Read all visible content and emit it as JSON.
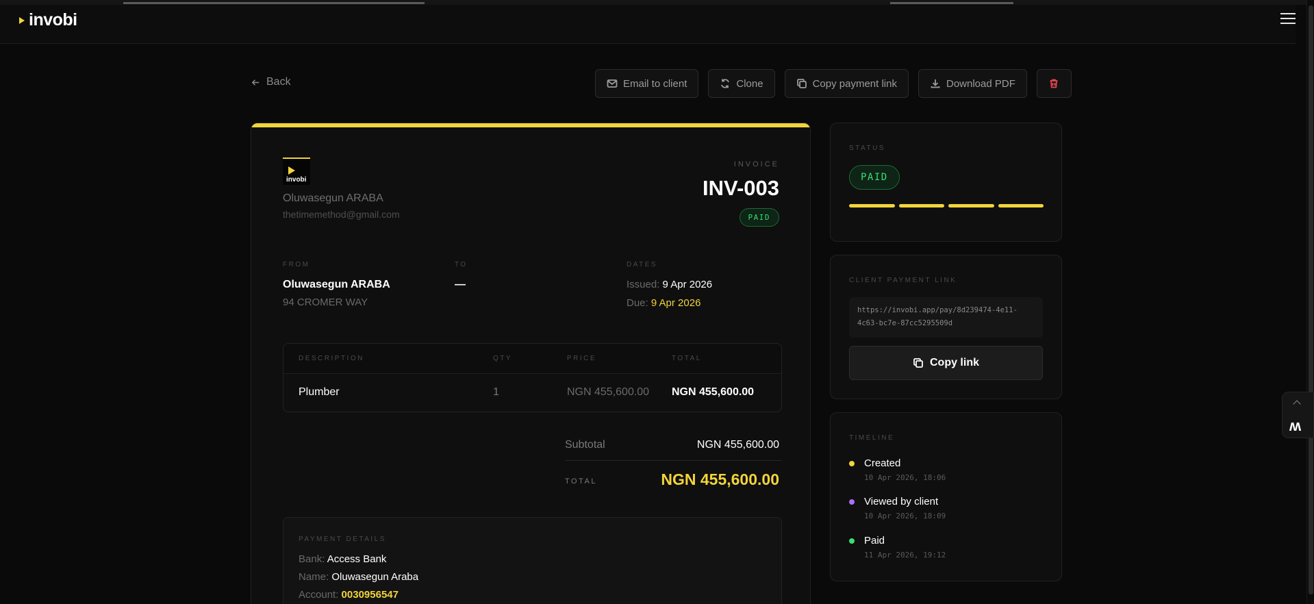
{
  "app": {
    "logo_text": "invobi"
  },
  "toolbar": {
    "back_label": "Back",
    "email_label": "Email to client",
    "clone_label": "Clone",
    "copy_payment_link_label": "Copy payment link",
    "download_pdf_label": "Download PDF"
  },
  "invoice": {
    "brand_text": "invobi",
    "sender_name": "Oluwasegun ARABA",
    "sender_email": "thetimemethod@gmail.com",
    "label": "INVOICE",
    "number": "INV-003",
    "status": "PAID",
    "from_label": "FROM",
    "from_name": "Oluwasegun ARABA",
    "from_address": "94 CROMER WAY",
    "to_label": "TO",
    "to_value": "—",
    "dates_label": "DATES",
    "issued_label": "Issued:",
    "issued_value": "9 Apr 2026",
    "due_label": "Due:",
    "due_value": "9 Apr 2026",
    "columns": [
      "DESCRIPTION",
      "QTY",
      "PRICE",
      "TOTAL"
    ],
    "items": [
      {
        "description": "Plumber",
        "qty": "1",
        "price": "NGN 455,600.00",
        "total": "NGN 455,600.00"
      }
    ],
    "subtotal_label": "Subtotal",
    "subtotal_value": "NGN 455,600.00",
    "total_label": "TOTAL",
    "total_value": "NGN 455,600.00",
    "payment": {
      "label": "PAYMENT DETAILS",
      "bank_label": "Bank:",
      "bank_value": "Access Bank",
      "name_label": "Name:",
      "name_value": "Oluwasegun Araba",
      "account_label": "Account:",
      "account_value": "0030956547"
    }
  },
  "status_panel": {
    "label": "STATUS",
    "badge": "PAID",
    "progress_fraction": 1.0
  },
  "link_panel": {
    "label": "CLIENT PAYMENT LINK",
    "url": "https://invobi.app/pay/8d239474-4e11-4c63-bc7e-87cc5295509d",
    "copy_label": "Copy link"
  },
  "timeline": {
    "label": "TIMELINE",
    "events": [
      {
        "label": "Created",
        "time": "10 Apr 2026, 18:06",
        "color": "#f2d43b"
      },
      {
        "label": "Viewed by client",
        "time": "10 Apr 2026, 18:09",
        "color": "#a970f0"
      },
      {
        "label": "Paid",
        "time": "11 Apr 2026, 19:12",
        "color": "#3ddc74"
      }
    ]
  },
  "colors": {
    "accent": "#f2d43b",
    "success": "#3ddc74",
    "danger": "#e5484d",
    "background": "#0a0a0a"
  },
  "icons": [
    "menu-icon",
    "arrow-left-icon",
    "mail-icon",
    "refresh-icon",
    "copy-icon",
    "download-icon",
    "trash-icon",
    "chevron-up-icon"
  ]
}
